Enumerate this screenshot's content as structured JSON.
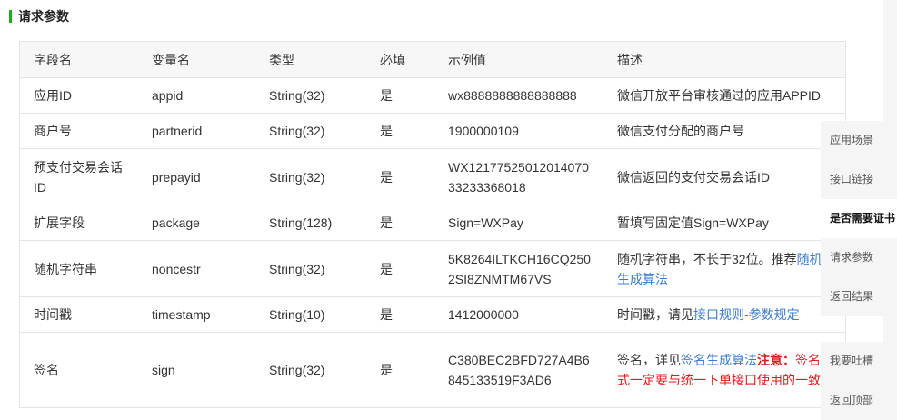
{
  "section": {
    "title": "请求参数"
  },
  "table": {
    "headers": [
      "字段名",
      "变量名",
      "类型",
      "必填",
      "示例值",
      "描述"
    ],
    "rows": [
      {
        "field": "应用ID",
        "var": "appid",
        "type": "String(32)",
        "required": "是",
        "example": "wx8888888888888888",
        "desc_parts": [
          {
            "text": "微信开放平台审核通过的应用APPID",
            "style": "normal"
          }
        ]
      },
      {
        "field": "商户号",
        "var": "partnerid",
        "type": "String(32)",
        "required": "是",
        "example": "1900000109",
        "desc_parts": [
          {
            "text": "微信支付分配的商户号",
            "style": "normal"
          }
        ]
      },
      {
        "field": "预支付交易会话ID",
        "var": "prepayid",
        "type": "String(32)",
        "required": "是",
        "example": "WX1217752501201407033233368018",
        "desc_parts": [
          {
            "text": "微信返回的支付交易会话ID",
            "style": "normal"
          }
        ]
      },
      {
        "field": "扩展字段",
        "var": "package",
        "type": "String(128)",
        "required": "是",
        "example": "Sign=WXPay",
        "desc_parts": [
          {
            "text": "暂填写固定值Sign=WXPay",
            "style": "normal"
          }
        ]
      },
      {
        "field": "随机字符串",
        "var": "noncestr",
        "type": "String(32)",
        "required": "是",
        "example": "5K8264ILTKCH16CQ2502SI8ZNMTM67VS",
        "desc_parts": [
          {
            "text": "随机字符串，不长于32位。推荐",
            "style": "normal"
          },
          {
            "text": "随机数生成算法",
            "style": "link"
          }
        ]
      },
      {
        "field": "时间戳",
        "var": "timestamp",
        "type": "String(10)",
        "required": "是",
        "example": "1412000000",
        "desc_parts": [
          {
            "text": "时间戳，请见",
            "style": "normal"
          },
          {
            "text": "接口规则-参数规定",
            "style": "link"
          }
        ]
      },
      {
        "field": "签名",
        "var": "sign",
        "type": "String(32)",
        "required": "是",
        "example": "C380BEC2BFD727A4B6845133519F3AD6",
        "desc_parts": [
          {
            "text": "签名，详见",
            "style": "normal"
          },
          {
            "text": "签名生成算法",
            "style": "link"
          },
          {
            "text": "注意：",
            "style": "red-bold"
          },
          {
            "text": "签名方式一定要与统一下单接口使用的一致",
            "style": "red"
          }
        ]
      }
    ]
  },
  "floatnav": {
    "items": [
      {
        "label": "应用场景",
        "active": false
      },
      {
        "label": "接口链接",
        "active": false
      },
      {
        "label": "是否需要证书",
        "active": true
      },
      {
        "label": "请求参数",
        "active": false
      },
      {
        "label": "返回结果",
        "active": false
      }
    ],
    "feedback": "我要吐槽",
    "back_top": "返回顶部"
  }
}
